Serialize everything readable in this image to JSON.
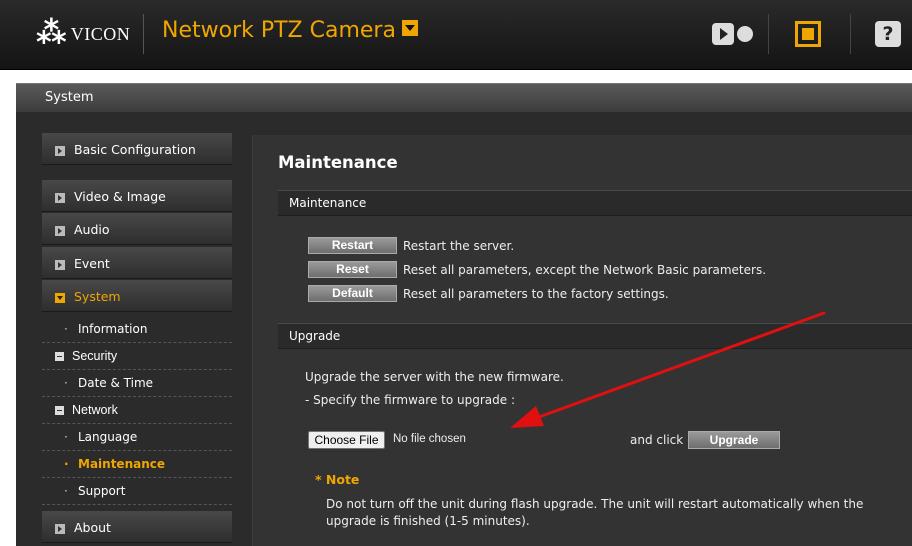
{
  "header": {
    "logo_text": "VICON",
    "app_title": "Network PTZ Camera",
    "icons": [
      "live-view-icon",
      "setup-icon",
      "help-icon"
    ],
    "help_glyph": "?"
  },
  "section": {
    "title": "System"
  },
  "sidebar": {
    "items": [
      {
        "label": "Basic Configuration"
      },
      {
        "label": "Video & Image"
      },
      {
        "label": "Audio"
      },
      {
        "label": "Event"
      },
      {
        "label": "System"
      },
      {
        "label": "About"
      }
    ],
    "sub_items": [
      {
        "label": "Information",
        "marker": "·"
      },
      {
        "label": "Security",
        "marker": "square"
      },
      {
        "label": "Date & Time",
        "marker": "·"
      },
      {
        "label": "Network",
        "marker": "square"
      },
      {
        "label": "Language",
        "marker": "·"
      },
      {
        "label": "Maintenance",
        "marker": "·",
        "selected": true
      },
      {
        "label": "Support",
        "marker": "·"
      }
    ]
  },
  "main": {
    "title": "Maintenance",
    "maintenance_section": {
      "header": "Maintenance",
      "actions": [
        {
          "button": "Restart",
          "description": "Restart the server."
        },
        {
          "button": "Reset",
          "description": "Reset all parameters, except the Network Basic parameters."
        },
        {
          "button": "Default",
          "description": "Reset all parameters to the factory settings."
        }
      ]
    },
    "upgrade_section": {
      "header": "Upgrade",
      "line1": "Upgrade the server with the new firmware.",
      "line2": "- Specify the firmware to upgrade :",
      "choose_file": "Choose File",
      "no_file": "No file chosen",
      "and_click": "and click",
      "upgrade_button": "Upgrade",
      "note_title": "* Note",
      "note_text": "Do not turn off the unit during flash upgrade. The unit will restart automatically when the upgrade is finished (1-5 minutes)."
    }
  },
  "colors": {
    "accent": "#f0a600",
    "annotation_arrow": "#e01010"
  }
}
